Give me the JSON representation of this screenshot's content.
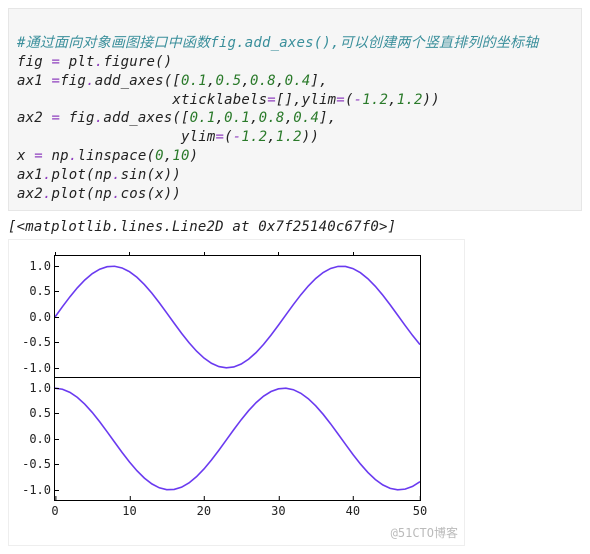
{
  "code": {
    "comment": "#通过面向对象画图接口中函数fig.add_axes(),可以创建两个竖直排列的坐标轴",
    "l1_a": "fig ",
    "l1_op": "=",
    "l1_b": " plt",
    "l1_dot": ".",
    "l1_c": "figure()",
    "l2_a": "ax1 ",
    "l2_op1": "=",
    "l2_b": "fig",
    "l2_dot": ".",
    "l2_c": "add_axes([",
    "l2_n1": "0.1",
    "l2_cm1": ",",
    "l2_n2": "0.5",
    "l2_cm2": ",",
    "l2_n3": "0.8",
    "l2_cm3": ",",
    "l2_n4": "0.4",
    "l2_close": "],",
    "l3_pad": "                  ",
    "l3_a": "xticklabels",
    "l3_op": "=",
    "l3_b": "[],ylim",
    "l3_op2": "=",
    "l3_p1": "(",
    "l3_neg1": "-",
    "l3_n1": "1.2",
    "l3_cm": ",",
    "l3_n2": "1.2",
    "l3_p2": "))",
    "l4_a": "ax2 ",
    "l4_op1": "=",
    "l4_b": " fig",
    "l4_dot": ".",
    "l4_c": "add_axes([",
    "l4_n1": "0.1",
    "l4_cm1": ",",
    "l4_n2": "0.1",
    "l4_cm2": ",",
    "l4_n3": "0.8",
    "l4_cm3": ",",
    "l4_n4": "0.4",
    "l4_close": "],",
    "l5_pad": "                   ",
    "l5_a": "ylim",
    "l5_op": "=",
    "l5_p1": "(",
    "l5_neg": "-",
    "l5_n1": "1.2",
    "l5_cm": ",",
    "l5_n2": "1.2",
    "l5_p2": "))",
    "l6_a": "x ",
    "l6_op": "=",
    "l6_b": " np",
    "l6_dot": ".",
    "l6_c": "linspace(",
    "l6_n1": "0",
    "l6_cm": ",",
    "l6_n2": "10",
    "l6_close": ")",
    "l7_a": "ax1",
    "l7_dot": ".",
    "l7_b": "plot(np",
    "l7_dot2": ".",
    "l7_c": "sin(x))",
    "l8_a": "ax2",
    "l8_dot": ".",
    "l8_b": "plot(np",
    "l8_dot2": ".",
    "l8_c": "cos(x))"
  },
  "output_line": "[<matplotlib.lines.Line2D at 0x7f25140c67f0>]",
  "chart_data": [
    {
      "type": "line",
      "title": "",
      "xlabel": "",
      "ylabel": "",
      "xticklabels": [],
      "yticks": [
        -1.0,
        -0.5,
        0.0,
        0.5,
        1.0
      ],
      "xlim": [
        0,
        49
      ],
      "ylim": [
        -1.2,
        1.2
      ],
      "series": [
        {
          "name": "sin(x)",
          "color": "#6a3af0",
          "x_desc": "index 0..49 of np.linspace(0,10)",
          "y_desc": "sin(linspace(0,10))"
        }
      ]
    },
    {
      "type": "line",
      "title": "",
      "xlabel": "",
      "ylabel": "",
      "xticks": [
        0,
        10,
        20,
        30,
        40,
        50
      ],
      "yticks": [
        -1.0,
        -0.5,
        0.0,
        0.5,
        1.0
      ],
      "xlim": [
        0,
        49
      ],
      "ylim": [
        -1.2,
        1.2
      ],
      "series": [
        {
          "name": "cos(x)",
          "color": "#6a3af0",
          "x_desc": "index 0..49 of np.linspace(0,10)",
          "y_desc": "cos(linspace(0,10))"
        }
      ]
    }
  ],
  "yticks_labels": [
    "1.0",
    "0.5",
    "0.0",
    "-0.5",
    "-1.0"
  ],
  "xticks_labels": [
    "0",
    "10",
    "20",
    "30",
    "40",
    "50"
  ],
  "watermark": "@51CTO博客"
}
